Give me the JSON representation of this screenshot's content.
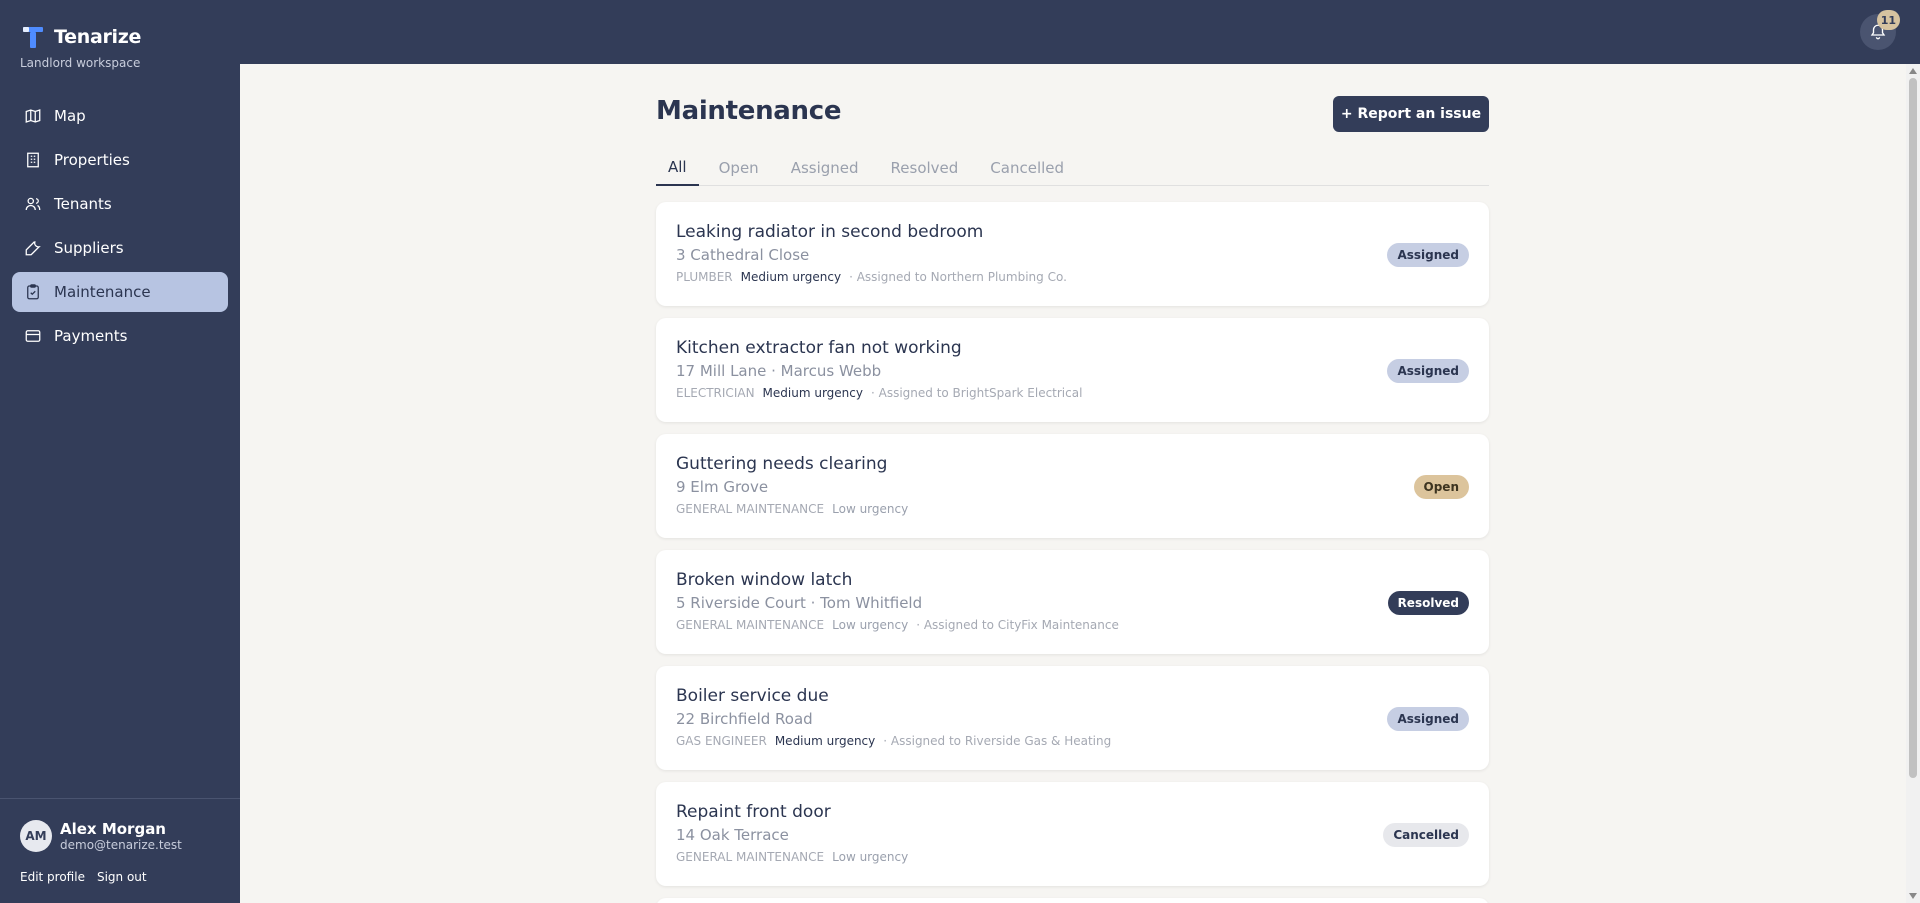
{
  "brand": {
    "name": "Tenarize",
    "subtitle": "Landlord workspace"
  },
  "nav": {
    "items": [
      {
        "label": "Map",
        "icon": "map-icon",
        "active": false
      },
      {
        "label": "Properties",
        "icon": "building-icon",
        "active": false
      },
      {
        "label": "Tenants",
        "icon": "users-icon",
        "active": false
      },
      {
        "label": "Suppliers",
        "icon": "wrench-icon",
        "active": false
      },
      {
        "label": "Maintenance",
        "icon": "clipboard-check-icon",
        "active": true
      },
      {
        "label": "Payments",
        "icon": "credit-card-icon",
        "active": false
      }
    ]
  },
  "user": {
    "initials": "AM",
    "name": "Alex Morgan",
    "email": "demo@tenarize.test",
    "edit_label": "Edit profile",
    "signout_label": "Sign out"
  },
  "header": {
    "notifications_count": "11",
    "notification_icon": "bell-icon"
  },
  "main": {
    "title": "Maintenance",
    "report_button": "+ Report an issue",
    "tabs": [
      {
        "label": "All",
        "active": true
      },
      {
        "label": "Open",
        "active": false
      },
      {
        "label": "Assigned",
        "active": false
      },
      {
        "label": "Resolved",
        "active": false
      },
      {
        "label": "Cancelled",
        "active": false
      }
    ],
    "issues": [
      {
        "title": "Leaking radiator in second bedroom",
        "subtitle": "3 Cathedral Close",
        "category": "PLUMBER",
        "urgency": "Medium urgency",
        "assigned": "· Assigned to Northern Plumbing Co.",
        "status": "Assigned"
      },
      {
        "title": "Kitchen extractor fan not working",
        "subtitle": "17 Mill Lane · Marcus Webb",
        "category": "ELECTRICIAN",
        "urgency": "Medium urgency",
        "assigned": "· Assigned to BrightSpark Electrical",
        "status": "Assigned"
      },
      {
        "title": "Guttering needs clearing",
        "subtitle": "9 Elm Grove",
        "category": "GENERAL MAINTENANCE",
        "urgency": "Low urgency",
        "assigned": "",
        "status": "Open"
      },
      {
        "title": "Broken window latch",
        "subtitle": "5 Riverside Court · Tom Whitfield",
        "category": "GENERAL MAINTENANCE",
        "urgency": "Low urgency",
        "assigned": "· Assigned to CityFix Maintenance",
        "status": "Resolved"
      },
      {
        "title": "Boiler service due",
        "subtitle": "22 Birchfield Road",
        "category": "GAS ENGINEER",
        "urgency": "Medium urgency",
        "assigned": "· Assigned to Riverside Gas & Heating",
        "status": "Assigned"
      },
      {
        "title": "Repaint front door",
        "subtitle": "14 Oak Terrace",
        "category": "GENERAL MAINTENANCE",
        "urgency": "Low urgency",
        "assigned": "",
        "status": "Cancelled"
      }
    ]
  },
  "colors": {
    "sidebar": "#333d59",
    "accent_active": "#b7c4e2",
    "page_bg": "#f6f5f2"
  }
}
